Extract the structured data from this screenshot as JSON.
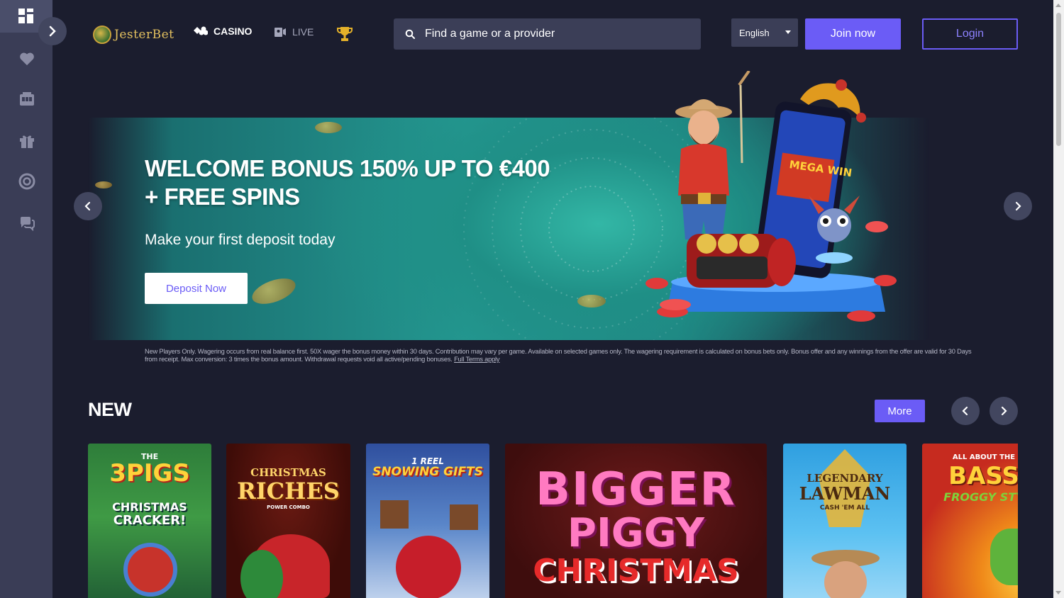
{
  "brand": {
    "name": "JesterBet"
  },
  "header": {
    "nav": [
      {
        "label": "CASINO",
        "icon": "cards-icon"
      },
      {
        "label": "LIVE",
        "icon": "live-dealer-icon"
      }
    ],
    "tournaments_icon": "trophy-icon",
    "search": {
      "placeholder": "Find a game or a provider",
      "value": ""
    },
    "language": "English",
    "join_label": "Join now",
    "login_label": "Login"
  },
  "sidebar": {
    "items": [
      {
        "icon": "dashboard-icon"
      },
      {
        "icon": "heart-icon"
      },
      {
        "icon": "slot-machine-icon"
      },
      {
        "icon": "gift-icon"
      },
      {
        "icon": "lifebuoy-icon"
      },
      {
        "icon": "chat-support-icon"
      }
    ]
  },
  "banner": {
    "title_line1": "WELCOME BONUS 150% UP TO €400",
    "title_line2": "+ FREE SPINS",
    "subtitle": "Make your first deposit today",
    "cta": "Deposit Now",
    "terms": "New Players Only. Wagering occurs from real balance first. 50X wager the bonus money within 30 days. Contribution may vary per game. Available on selected games only. The wagering requirement is calculated on bonus bets only. Bonus offer and any winnings from the offer are valid for 30 Days from receipt. Max conversion: 3 times the bonus amount. Withdrawal requests void all active/pending bonuses.",
    "terms_link": "Full Terms apply",
    "art": {
      "sign_mega_win": "MEGA WIN"
    }
  },
  "new_section": {
    "title": "NEW",
    "more_label": "More",
    "games": [
      {
        "line1": "THE",
        "line2": "3PIGS",
        "line3": "CHRISTMAS",
        "line4": "CRACKER!"
      },
      {
        "line1": "CHRISTMAS",
        "line2": "RICHES",
        "line3": "POWER COMBO"
      },
      {
        "line1": "1 REEL",
        "line2": "SNOWING GIFTS"
      },
      {
        "line1": "BIGGER",
        "line2": "PIGGY",
        "line3": "CHRISTMAS"
      },
      {
        "line1": "LEGENDARY",
        "line2": "LAWMAN",
        "line3": "CASH 'EM ALL"
      },
      {
        "line1": "ALL ABOUT THE",
        "line2": "BASS",
        "line3": "FROGGY STY"
      }
    ]
  },
  "colors": {
    "accent": "#6b5cf6",
    "background": "#1b1d2e",
    "sidebar": "#3a3d56",
    "gold": "#e4c15f"
  }
}
